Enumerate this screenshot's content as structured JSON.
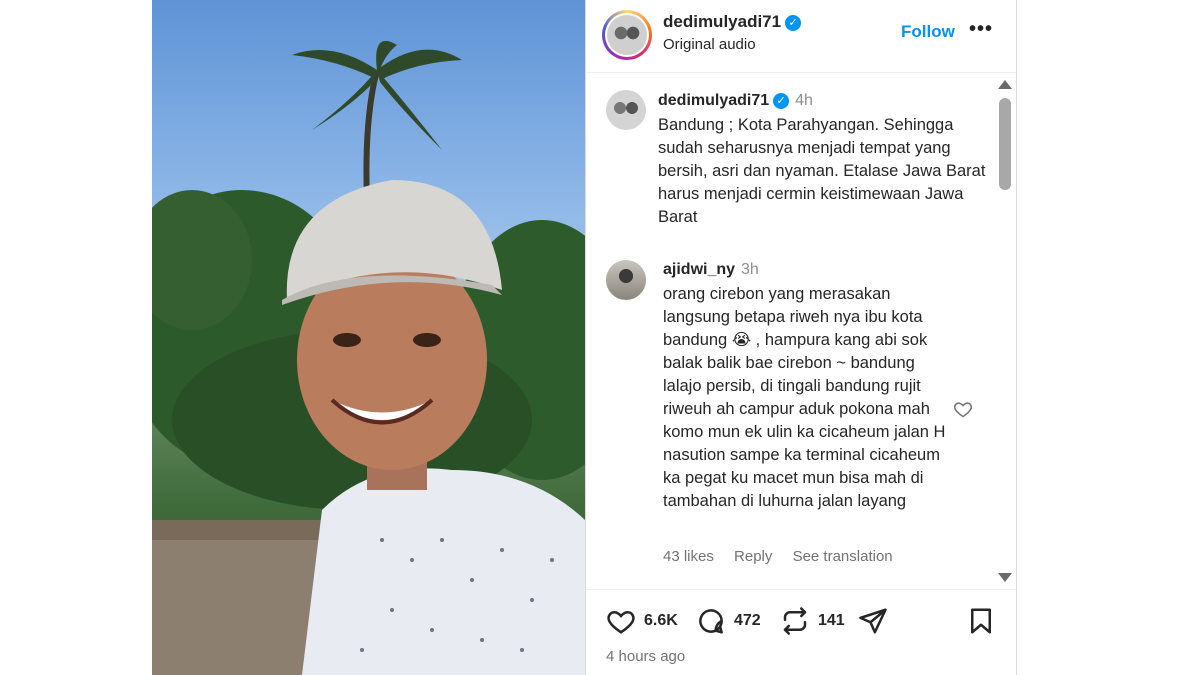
{
  "header": {
    "username": "dedimulyadi71",
    "verified_icon": "verified-badge-icon",
    "audio": "Original audio",
    "follow_label": "Follow",
    "more_label": "•••"
  },
  "comments": [
    {
      "username": "dedimulyadi71",
      "verified": true,
      "time": "4h",
      "text": "Bandung ; Kota Parahyangan. Sehingga sudah seharusnya menjadi tempat yang bersih, asri dan nyaman. Etalase Jawa Barat harus menjadi cermin keistimewaan Jawa Barat"
    },
    {
      "username": "ajidwi_ny",
      "verified": false,
      "time": "3h",
      "text": "orang cirebon yang merasakan langsung betapa riweh nya ibu kota bandung 😭 , hampura kang abi sok balak balik bae cirebon ~ bandung lalajo persib, di tingali bandung rujit riweuh ah campur aduk pokona mah komo mun ek ulin ka cicaheum jalan H nasution sampe ka terminal cicaheum ka pegat ku macet mun bisa mah di tambahan di luhurna jalan layang",
      "likes": "43 likes",
      "reply_label": "Reply",
      "translate_label": "See translation"
    }
  ],
  "actions": {
    "likes": "6.6K",
    "comments": "472",
    "reposts": "141"
  },
  "posted": "4 hours ago",
  "colors": {
    "accent": "#0095f6",
    "text": "#262626",
    "muted": "#737373"
  }
}
